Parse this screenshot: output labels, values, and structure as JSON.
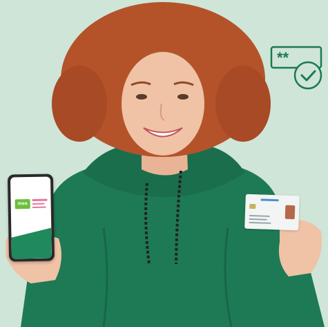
{
  "scene": {
    "description_colors": {
      "background": "#cfe5d8",
      "hoodie": "#1d7a55",
      "hair": "#b4532a",
      "skin": "#f0c2a6",
      "accent_green": "#1f8a5c"
    }
  },
  "pin_badge": {
    "icon": "pin-check-icon",
    "mask_text": "**"
  },
  "phone": {
    "icon": "smartphone-icon",
    "logo_text": "mea"
  },
  "id_card": {
    "icon": "id-card-icon"
  }
}
